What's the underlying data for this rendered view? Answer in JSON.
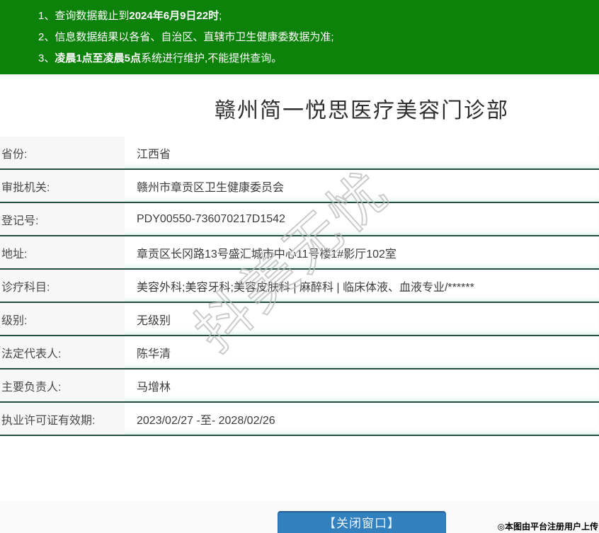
{
  "notices": {
    "items": [
      {
        "num": "1、",
        "pre": "查询数据截止到",
        "bold": "2024年6月9日22时",
        "post": ";"
      },
      {
        "num": "2、",
        "pre": "信息数据结果以各省、自治区、直辖市卫生健康委数据为准;",
        "bold": "",
        "post": ""
      },
      {
        "num": "3、",
        "pre": "",
        "bold": "凌晨1点至凌晨5点",
        "post": "系统进行维护,不能提供查询。"
      }
    ]
  },
  "title": "赣州简一悦思医疗美容门诊部",
  "table": {
    "rows": [
      {
        "label": "省份:",
        "value": "江西省"
      },
      {
        "label": "审批机关:",
        "value": "赣州市章贡区卫生健康委员会"
      },
      {
        "label": "登记号:",
        "value": "PDY00550-736070217D1542"
      },
      {
        "label": "地址:",
        "value": "章贡区长冈路13号盛汇城市中心11号楼1#影厅102室"
      },
      {
        "label": "诊疗科目:",
        "value": "美容外科;美容牙科;美容皮肤科 | 麻醉科 | 临床体液、血液专业/******"
      },
      {
        "label": "级别:",
        "value": "无级别"
      },
      {
        "label": "法定代表人:",
        "value": "陈华清"
      },
      {
        "label": "主要负责人:",
        "value": "马增林"
      },
      {
        "label": "执业许可证有效期:",
        "value": "2023/02/27 -至- 2028/02/26"
      }
    ]
  },
  "watermark": "抖美无忧",
  "footer": {
    "close_button": "【关闭窗口】",
    "caption": "◎本图由平台注册用户上传"
  },
  "colors": {
    "notice_green": "#0d820b",
    "divider_dark_teal": "#234c43",
    "label_bg": "#f7f7f7",
    "button_blue": "#3380bf",
    "button_border_blue": "#2a6da6",
    "watermark_gray": "#b9b9b9"
  }
}
